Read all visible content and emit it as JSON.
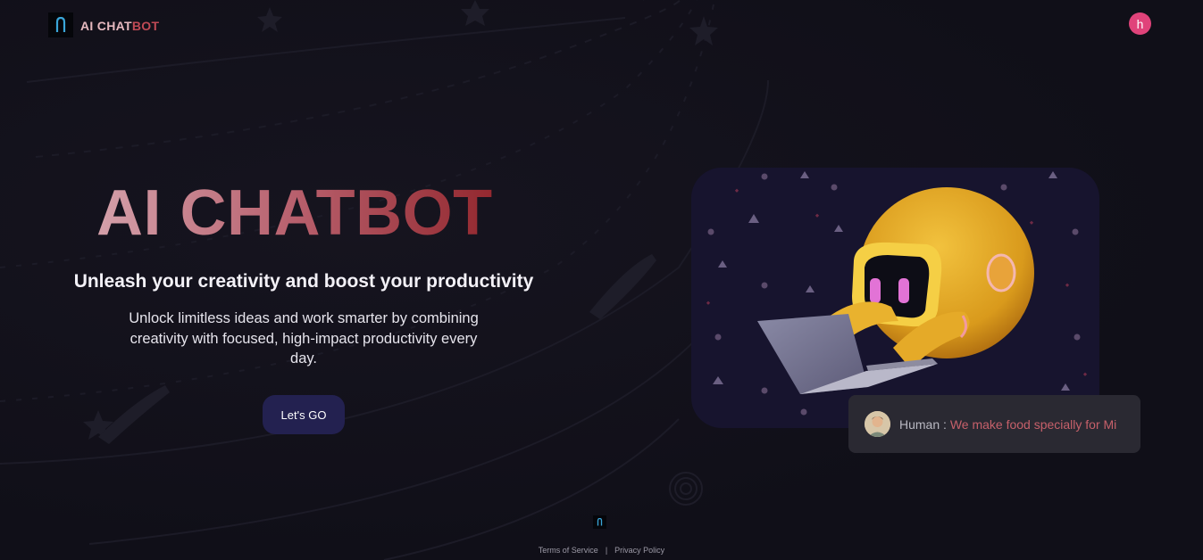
{
  "header": {
    "brand_part1": "AI CHAT",
    "brand_part2": "BOT",
    "user_initial": "h",
    "logo_icon": "logo-icon",
    "avatar_color": "#e0437a"
  },
  "hero": {
    "title": "AI CHATBOT",
    "subtitle": "Unleash your creativity and boost your productivity",
    "description": "Unlock limitless ideas and work smarter by combining creativity with focused, high-impact productivity every day.",
    "cta_label": "Let's GO"
  },
  "chat_preview": {
    "speaker": "Human : ",
    "message": "We make food specially for Mi"
  },
  "footer": {
    "terms": "Terms of Service",
    "separator": "|",
    "privacy": "Privacy Policy"
  },
  "colors": {
    "background": "#11101b",
    "accent_red": "#93282f",
    "accent_pink": "#d4a0aa",
    "button": "#232150",
    "card": "#17142e"
  }
}
